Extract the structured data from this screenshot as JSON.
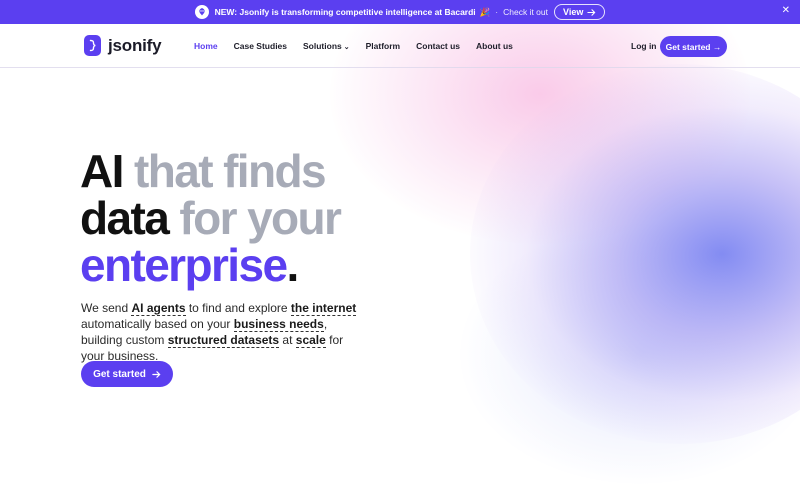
{
  "announcement": {
    "text": "NEW: Jsonify is transforming competitive intelligence at Bacardi",
    "emoji": "🎉",
    "separator": "·",
    "check_text": "Check it out",
    "view_label": "View",
    "close_label": "✕"
  },
  "nav": {
    "brand": "jsonify",
    "items": [
      {
        "label": "Home"
      },
      {
        "label": "Case Studies"
      },
      {
        "label": "Solutions"
      },
      {
        "label": "Platform"
      },
      {
        "label": "Contact us"
      },
      {
        "label": "About us"
      }
    ],
    "login": "Log in",
    "cta": "Get started →"
  },
  "hero": {
    "line1_a": "AI",
    "line1_b": " that finds",
    "line2_a": "data",
    "line2_b": " for your",
    "line3_a": "enterprise",
    "line3_b": ".",
    "sub": {
      "s1": "We send ",
      "u1": "AI agents",
      "s2": " to find and explore ",
      "u2": "the internet",
      "s3": " automatically based on your ",
      "u3": "business needs",
      "s4": ", building custom ",
      "u4": "structured datasets",
      "s5": " at ",
      "u5": "scale",
      "s6": " for your business."
    },
    "cta": "Get started"
  },
  "colors": {
    "brand": "#5b3ff0",
    "heading_dark": "#111111",
    "heading_gray": "#a7abb7"
  }
}
